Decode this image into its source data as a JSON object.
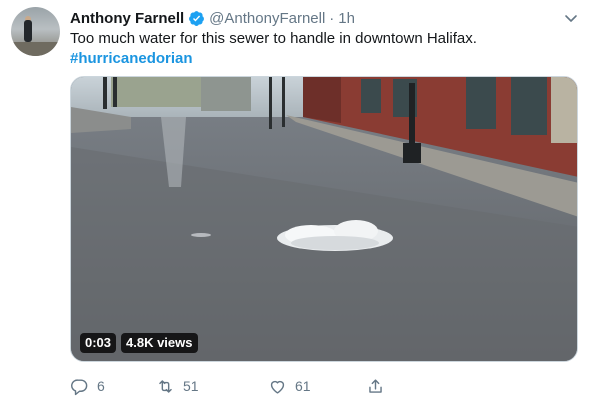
{
  "author": {
    "display_name": "Anthony Farnell",
    "handle": "@AnthonyFarnell",
    "time": "1h",
    "dot": "·"
  },
  "tweet": {
    "text": "Too much water for this sewer to handle in downtown Halifax.",
    "hashtag": "#hurricanedorian"
  },
  "media": {
    "duration": "0:03",
    "views": "4.8K views"
  },
  "actions": {
    "replies": "6",
    "retweets": "51",
    "likes": "61"
  },
  "icons": {
    "verified": "verified-badge-icon",
    "menu": "chevron-down-icon",
    "reply": "reply-icon",
    "retweet": "retweet-icon",
    "like": "heart-icon",
    "share": "share-icon"
  },
  "colors": {
    "text": "#14171a",
    "secondary": "#657786",
    "hashtag": "#1b95e0",
    "verified": "#1da1f2"
  }
}
